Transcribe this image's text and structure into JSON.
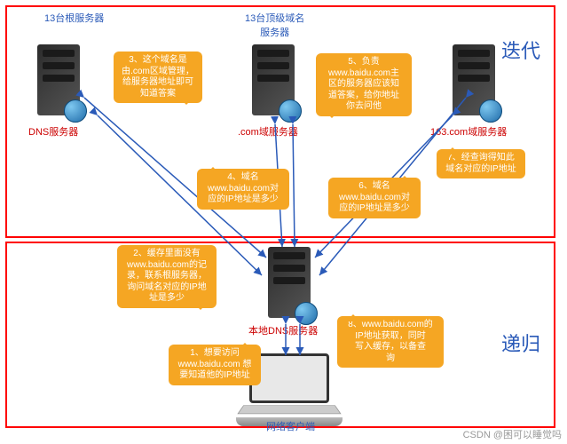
{
  "top_labels": {
    "root_count": "13台根服务器",
    "tld_count": "13台顶级域名\n服务器"
  },
  "section_labels": {
    "iterative": "迭代",
    "recursive": "递归"
  },
  "server_labels": {
    "dns": "DNS服务器",
    "com": ".com域服务器",
    "163": "163.com域服务器",
    "local": "本地DNS服务器",
    "client": "网络客户端"
  },
  "bubbles": {
    "b1": "1、想要访问\nwww.baidu.com 想\n要知道他的IP地址",
    "b2": "2、缓存里面没有\nwww.baidu.com的记\n录，联系根服务器，\n询问域名对应的IP地\n址是多少",
    "b3": "3、这个域名是\n由.com区域管理，\n给服务器地址即可\n知道答案",
    "b4": "4、域名\nwww.baidu.com对\n应的IP地址是多少",
    "b5": "5、负责\nwww.baidu.com主\n区的服务器应该知\n道答案，给你地址\n你去问他",
    "b6": "6、域名\nwww.baidu.com对\n应的IP地址是多少",
    "b7": "7、经查询得知此\n域名对应的IP地址",
    "b8": "8、www.baidu.com的\nIP地址获取，同时\n写入缓存，以备查\n询"
  },
  "watermark": "CSDN @困可以睡觉吗"
}
